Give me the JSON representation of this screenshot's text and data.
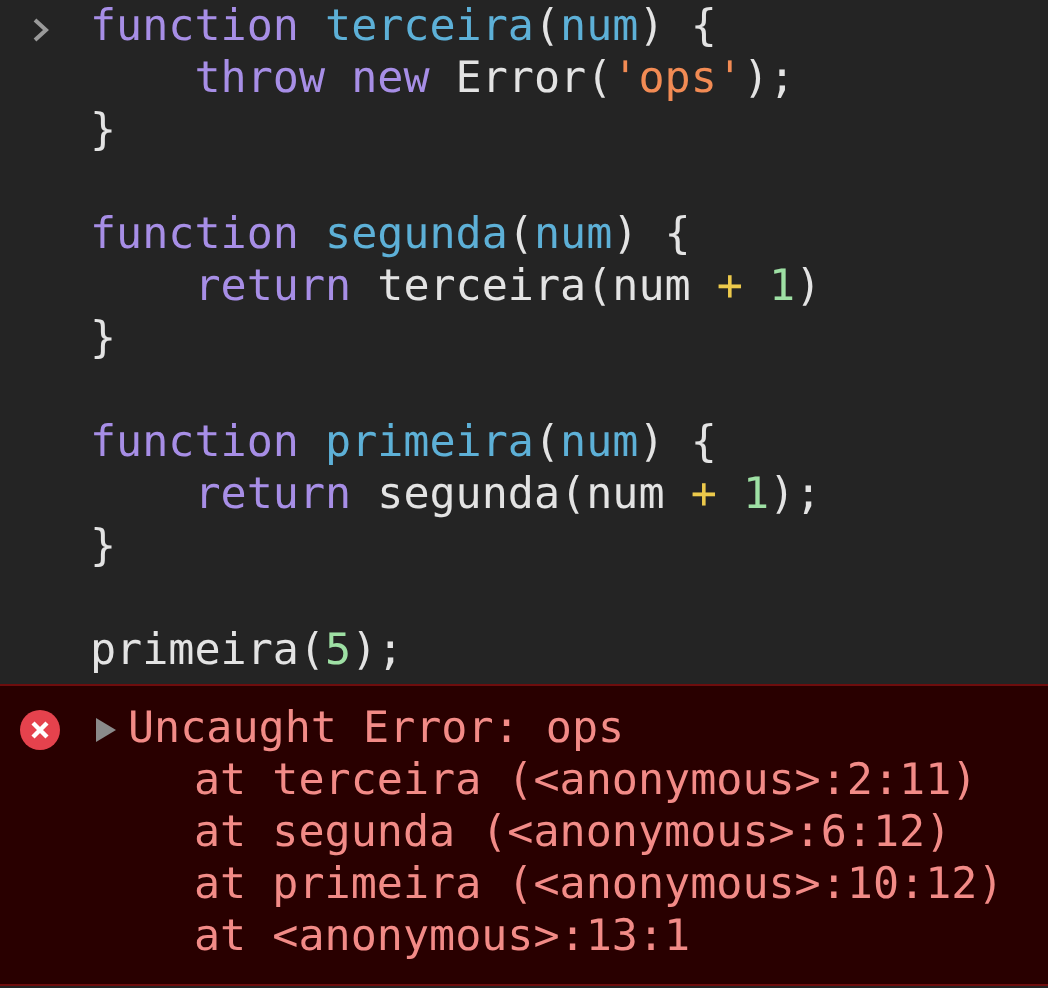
{
  "console": {
    "lines": [
      {
        "kind": "code",
        "tokens": [
          {
            "text": "function ",
            "kind": "keyword"
          },
          {
            "text": "terceira",
            "kind": "name"
          },
          {
            "text": "(",
            "kind": "plain"
          },
          {
            "text": "num",
            "kind": "name"
          },
          {
            "text": ") {",
            "kind": "plain"
          }
        ]
      },
      {
        "kind": "code",
        "tokens": [
          {
            "text": "    throw ",
            "kind": "keyword"
          },
          {
            "text": "new",
            "kind": "keyword"
          },
          {
            "text": " Error(",
            "kind": "plain"
          },
          {
            "text": "'ops'",
            "kind": "string"
          },
          {
            "text": ");",
            "kind": "plain"
          }
        ]
      },
      {
        "kind": "code",
        "tokens": [
          {
            "text": "}",
            "kind": "plain"
          }
        ]
      },
      {
        "kind": "blank"
      },
      {
        "kind": "code",
        "tokens": [
          {
            "text": "function ",
            "kind": "keyword"
          },
          {
            "text": "segunda",
            "kind": "name"
          },
          {
            "text": "(",
            "kind": "plain"
          },
          {
            "text": "num",
            "kind": "name"
          },
          {
            "text": ") {",
            "kind": "plain"
          }
        ]
      },
      {
        "kind": "code",
        "tokens": [
          {
            "text": "    return",
            "kind": "keyword"
          },
          {
            "text": " terceira(num ",
            "kind": "plain"
          },
          {
            "text": "+ ",
            "kind": "operator"
          },
          {
            "text": "1",
            "kind": "number"
          },
          {
            "text": ")",
            "kind": "plain"
          }
        ]
      },
      {
        "kind": "code",
        "tokens": [
          {
            "text": "}",
            "kind": "plain"
          }
        ]
      },
      {
        "kind": "blank"
      },
      {
        "kind": "code",
        "tokens": [
          {
            "text": "function ",
            "kind": "keyword"
          },
          {
            "text": "primeira",
            "kind": "name"
          },
          {
            "text": "(",
            "kind": "plain"
          },
          {
            "text": "num",
            "kind": "name"
          },
          {
            "text": ") {",
            "kind": "plain"
          }
        ]
      },
      {
        "kind": "code",
        "tokens": [
          {
            "text": "    return",
            "kind": "keyword"
          },
          {
            "text": " segunda(num ",
            "kind": "plain"
          },
          {
            "text": "+ ",
            "kind": "operator"
          },
          {
            "text": "1",
            "kind": "number"
          },
          {
            "text": ");",
            "kind": "plain"
          }
        ]
      },
      {
        "kind": "code",
        "tokens": [
          {
            "text": "}",
            "kind": "plain"
          }
        ]
      },
      {
        "kind": "blank"
      },
      {
        "kind": "code",
        "tokens": [
          {
            "text": "primeira(",
            "kind": "plain"
          },
          {
            "text": "5",
            "kind": "number"
          },
          {
            "text": ");",
            "kind": "plain"
          }
        ]
      }
    ],
    "error": {
      "expanded": false,
      "message": "Uncaught Error: ops",
      "stack": [
        "at terceira (<anonymous>:2:11)",
        "at segunda (<anonymous>:6:12)",
        "at primeira (<anonymous>:10:12)",
        "at <anonymous>:13:1"
      ]
    }
  }
}
